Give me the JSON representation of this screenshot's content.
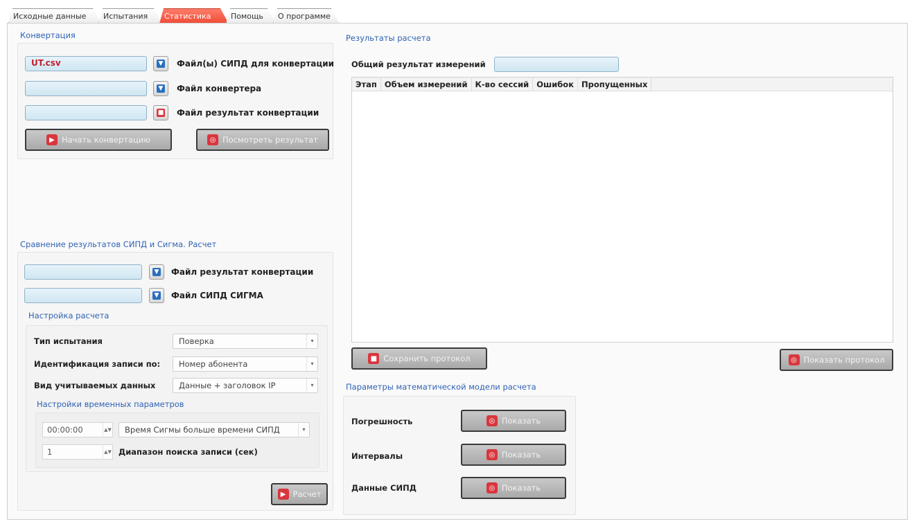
{
  "tabs": [
    "Исходные данные",
    "Испытания",
    "Статистика",
    "Помощь",
    "О программе"
  ],
  "active_tab": 2,
  "conversion": {
    "title": "Конвертация",
    "sipd_files": {
      "value": "UT.csv",
      "label": "Файл(ы) СИПД для конвертации"
    },
    "converter_file": {
      "value": "",
      "label": "Файл конвертера"
    },
    "result_file": {
      "value": "",
      "label": "Файл результат конвертации"
    },
    "start_button": "Начать конвертацию",
    "view_button": "Посмотреть результат"
  },
  "comparison": {
    "title": "Сравнение результатов СИПД и Сигма. Расчет",
    "conv_result_file": {
      "value": "",
      "label": "Файл результат конвертации"
    },
    "sigma_file": {
      "value": "",
      "label": "Файл СИПД  СИГМА"
    },
    "settings_title": "Настройка расчета",
    "test_type": {
      "label": "Тип испытания",
      "value": "Поверка"
    },
    "record_id": {
      "label": "Идентификация записи по:",
      "value": "Номер абонента"
    },
    "data_kind": {
      "label": "Вид учитываемых данных",
      "value": "Данные + заголовок IP"
    },
    "time_title": "Настройки временных параметров",
    "time_offset": "00:00:00",
    "time_mode": "Время Сигмы больше времени СИПД",
    "search_range": "1",
    "search_range_label": "Диапазон поиска записи (сек)",
    "calc_button": "Расчет"
  },
  "results": {
    "title": "Результаты расчета",
    "total_label": "Общий результат измерений",
    "total_value": "",
    "columns": [
      "Этап",
      "Объем измерений",
      "К-во сессий",
      "Ошибок",
      "Пропущенных"
    ],
    "save_button": "Сохранить протокол",
    "show_button": "Показать протокол"
  },
  "math_model": {
    "title": "Параметры математической модели расчета",
    "rows": [
      {
        "label": "Погрешность",
        "button": "Показать"
      },
      {
        "label": "Интервалы",
        "button": "Показать"
      },
      {
        "label": "Данные СИПД",
        "button": "Показать"
      }
    ]
  },
  "colors": {
    "accent_tab": "#ee4b35",
    "group_title": "#2f62b4",
    "field_bg": "#cfe6f2",
    "field_text": "#c41d2f"
  }
}
